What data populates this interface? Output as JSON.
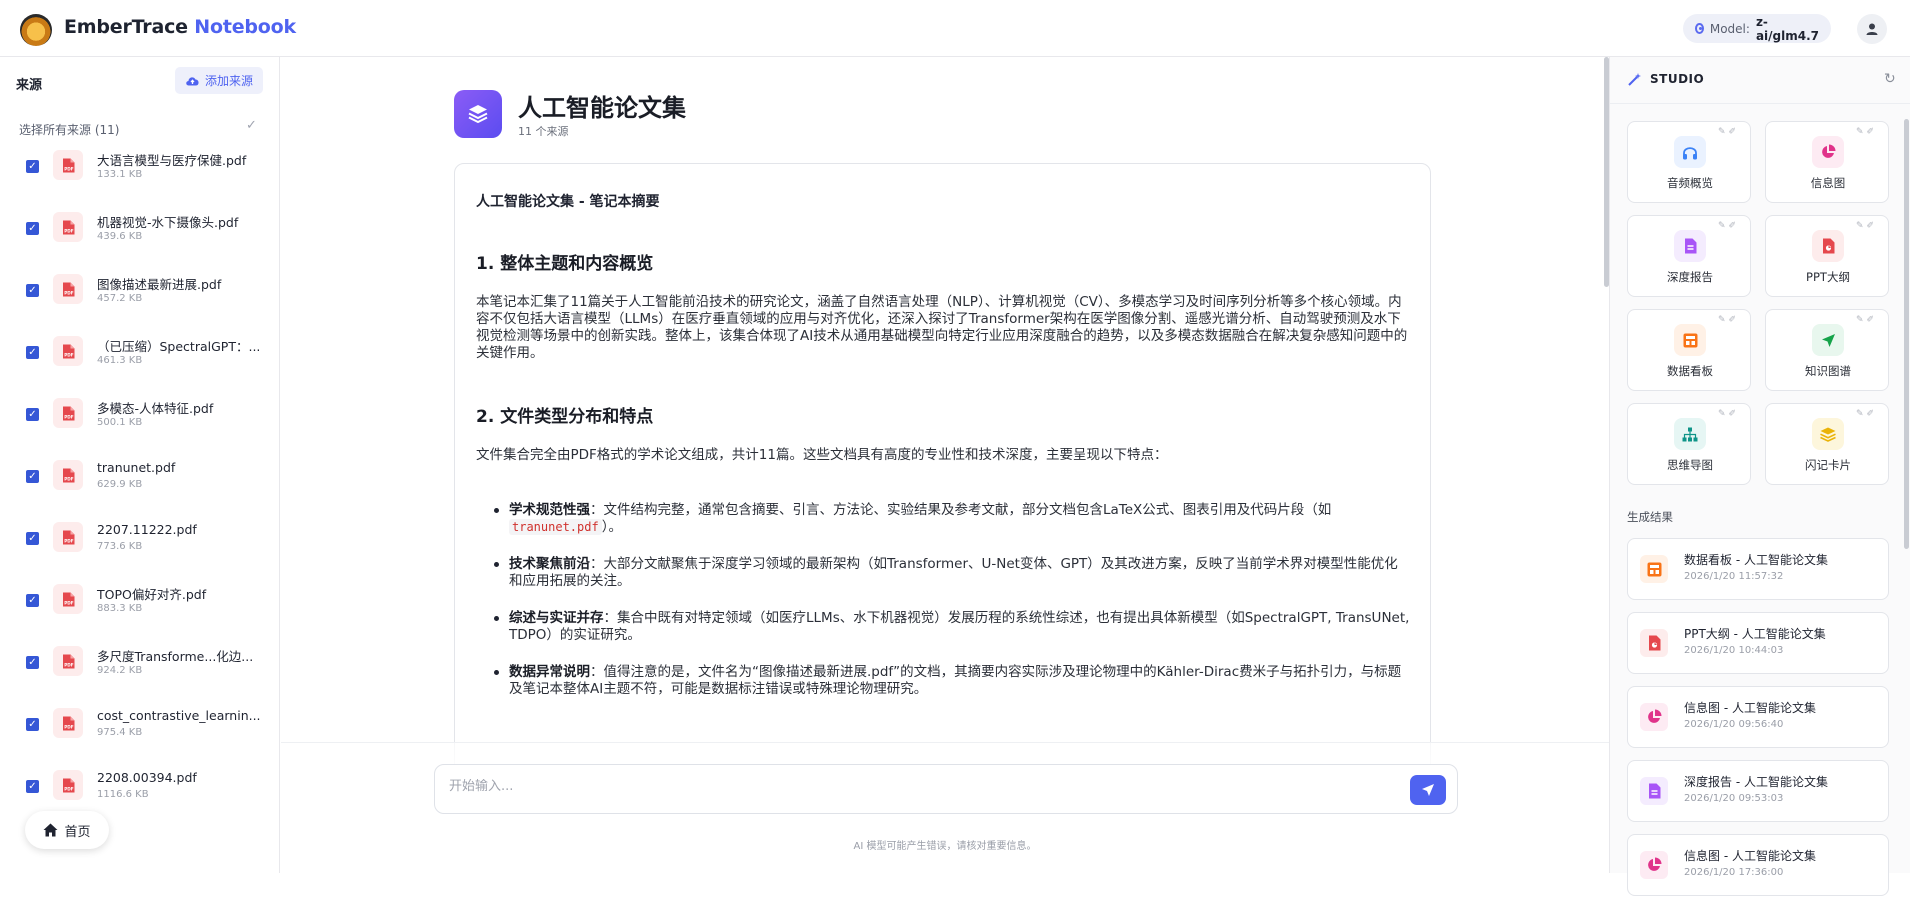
{
  "header": {
    "brand_main": "EmberTrace",
    "brand_accent": "Notebook",
    "model_label": "Model:",
    "model_value": "z-ai/glm4.7"
  },
  "sidebar": {
    "title": "来源",
    "add_source": "添加来源",
    "select_all": "选择所有来源 (11)",
    "sources": [
      {
        "name": "大语言模型与医疗保健.pdf",
        "size": "133.1 KB",
        "checked": true
      },
      {
        "name": "机器视觉-水下摄像头.pdf",
        "size": "439.6 KB",
        "checked": true
      },
      {
        "name": "图像描述最新进展.pdf",
        "size": "457.2 KB",
        "checked": true
      },
      {
        "name": "（已压缩）SpectralGPT：...",
        "size": "461.3 KB",
        "checked": true
      },
      {
        "name": "多模态-人体特征.pdf",
        "size": "500.1 KB",
        "checked": true
      },
      {
        "name": "tranunet.pdf",
        "size": "629.9 KB",
        "checked": true
      },
      {
        "name": "2207.11222.pdf",
        "size": "773.6 KB",
        "checked": true
      },
      {
        "name": "TOPO偏好对齐.pdf",
        "size": "883.3 KB",
        "checked": true
      },
      {
        "name": "多尺度Transforme...化边...",
        "size": "924.2 KB",
        "checked": true
      },
      {
        "name": "cost_contrastive_learnin...",
        "size": "975.4 KB",
        "checked": true
      },
      {
        "name": "2208.00394.pdf",
        "size": "1116.6 KB",
        "checked": true
      }
    ],
    "home": "首页"
  },
  "main": {
    "title": "人工智能论文集",
    "source_count": "11 个来源",
    "doc": {
      "summary_title": "人工智能论文集 - 笔记本摘要",
      "s1_title": "1. 整体主题和内容概览",
      "s1_text": "本笔记本汇集了11篇关于人工智能前沿技术的研究论文，涵盖了自然语言处理（NLP）、计算机视觉（CV）、多模态学习及时间序列分析等多个核心领域。内容不仅包括大语言模型（LLMs）在医疗垂直领域的应用与对齐优化，还深入探讨了Transformer架构在医学图像分割、遥感光谱分析、自动驾驶预测及水下视觉检测等场景中的创新实践。整体上，该集合体现了AI技术从通用基础模型向特定行业应用深度融合的趋势，以及多模态数据融合在解决复杂感知问题中的关键作用。",
      "s2_title": "2. 文件类型分布和特点",
      "s2_text": "文件集合完全由PDF格式的学术论文组成，共计11篇。这些文档具有高度的专业性和技术深度，主要呈现以下特点：",
      "b1_title": "学术规范性强",
      "b1_text_a": "：文件结构完整，通常包含摘要、引言、方法论、实验结果及参考文献，部分文档包含LaTeX公式、图表引用及代码片段（如",
      "b1_code": "tranunet.pdf",
      "b1_text_b": "）。",
      "b2_title": "技术聚焦前沿",
      "b2_text": "：大部分文献聚焦于深度学习领域的最新架构（如Transformer、U-Net变体、GPT）及其改进方案，反映了当前学术界对模型性能优化和应用拓展的关注。",
      "b3_title": "综述与实证并存",
      "b3_text": "：集合中既有对特定领域（如医疗LLMs、水下机器视觉）发展历程的系统性综述，也有提出具体新模型（如SpectralGPT, TransUNet, TDPO）的实证研究。",
      "b4_title": "数据异常说明",
      "b4_text": "：值得注意的是，文件名为“图像描述最新进展.pdf”的文档，其摘要内容实际涉及理论物理中的Kähler-Dirac费米子与拓扑引力，与标题及笔记本整体AI主题不符，可能是数据标注错误或特殊理论物理研究。"
    },
    "chat_placeholder": "开始输入...",
    "disclaimer": "AI 模型可能产生错误，请核对重要信息。"
  },
  "studio": {
    "title": "STUDIO",
    "tiles": [
      {
        "label": "音频概览",
        "icon": "headphones-icon",
        "color": "#3b82f6",
        "bg": "#eaf2ff"
      },
      {
        "label": "信息图",
        "icon": "pie-chart-icon",
        "color": "#e0338a",
        "bg": "#fdebf3"
      },
      {
        "label": "深度报告",
        "icon": "document-icon",
        "color": "#a855f7",
        "bg": "#f4ecfe"
      },
      {
        "label": "PPT大纲",
        "icon": "slides-icon",
        "color": "#e5484d",
        "bg": "#fdecec"
      },
      {
        "label": "数据看板",
        "icon": "dashboard-icon",
        "color": "#f97316",
        "bg": "#fff1e6"
      },
      {
        "label": "知识图谱",
        "icon": "share-graph-icon",
        "color": "#16a34a",
        "bg": "#e8f7ee"
      },
      {
        "label": "思维导图",
        "icon": "mindmap-icon",
        "color": "#0d9488",
        "bg": "#e6f6f4"
      },
      {
        "label": "闪记卡片",
        "icon": "layers-icon",
        "color": "#eab308",
        "bg": "#fdf6dc"
      }
    ],
    "results_label": "生成结果",
    "results": [
      {
        "title": "数据看板 - 人工智能论文集",
        "date": "2026/1/20 11:57:32",
        "icon": "dashboard-icon",
        "color": "#f97316",
        "bg": "#fff1e6"
      },
      {
        "title": "PPT大纲 - 人工智能论文集",
        "date": "2026/1/20 10:44:03",
        "icon": "slides-icon",
        "color": "#e5484d",
        "bg": "#fdecec"
      },
      {
        "title": "信息图 - 人工智能论文集",
        "date": "2026/1/20 09:56:40",
        "icon": "pie-chart-icon",
        "color": "#e0338a",
        "bg": "#fdebf3"
      },
      {
        "title": "深度报告 - 人工智能论文集",
        "date": "2026/1/20 09:53:03",
        "icon": "document-icon",
        "color": "#a855f7",
        "bg": "#f4ecfe"
      },
      {
        "title": "信息图 - 人工智能论文集",
        "date": "2026/1/20 17:36:00",
        "icon": "pie-chart-icon",
        "color": "#e0338a",
        "bg": "#fdebf3"
      }
    ]
  }
}
